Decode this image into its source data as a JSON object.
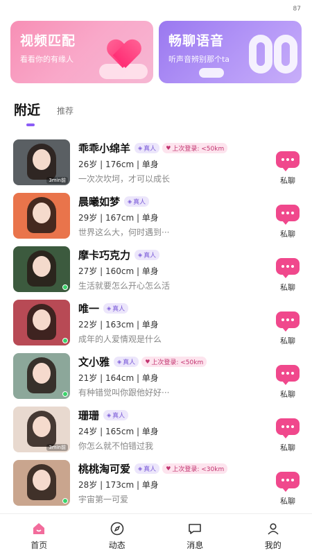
{
  "status_bar": {
    "battery": "87"
  },
  "banners": [
    {
      "title": "视频匹配",
      "subtitle": "看看你的有缘人"
    },
    {
      "title": "畅聊语音",
      "subtitle": "听声音辨别那个ta"
    }
  ],
  "tabs": {
    "active": "附近",
    "inactive": "推荐"
  },
  "users": [
    {
      "name": "乖乖小绵羊",
      "real": "真人",
      "login": "上次登录: <50km",
      "stats": "26岁 | 176cm | 单身",
      "bio": "一次次坎坷，才可以成长",
      "time": "3min前",
      "online": false,
      "chat": "私聊",
      "bg": "#5a5f63"
    },
    {
      "name": "晨曦如梦",
      "real": "真人",
      "login": "",
      "stats": "29岁 | 167cm | 单身",
      "bio": "世界这么大，何时遇到···",
      "time": "",
      "online": false,
      "chat": "私聊",
      "bg": "#e9744b"
    },
    {
      "name": "摩卡巧克力",
      "real": "真人",
      "login": "",
      "stats": "27岁 | 160cm | 单身",
      "bio": "生活就要怎么开心怎么活",
      "time": "",
      "online": true,
      "chat": "私聊",
      "bg": "#3c5a3e"
    },
    {
      "name": "唯一",
      "real": "真人",
      "login": "",
      "stats": "22岁 | 163cm | 单身",
      "bio": "成年的人爱情观是什么",
      "time": "",
      "online": true,
      "chat": "私聊",
      "bg": "#b84a55"
    },
    {
      "name": "文小雅",
      "real": "真人",
      "login": "上次登录: <50km",
      "stats": "21岁 | 164cm | 单身",
      "bio": "有种错觉叫你跟他好好···",
      "time": "",
      "online": true,
      "chat": "私聊",
      "bg": "#8ca79a"
    },
    {
      "name": "珊珊",
      "real": "真人",
      "login": "",
      "stats": "24岁 | 165cm | 单身",
      "bio": "你怎么就不怕错过我",
      "time": "3min前",
      "online": false,
      "chat": "私聊",
      "bg": "#e8d9cf"
    },
    {
      "name": "桃桃淘可爱",
      "real": "真人",
      "login": "上次登录: <30km",
      "stats": "28岁 | 173cm | 单身",
      "bio": "宇宙第一可爱",
      "time": "",
      "online": true,
      "chat": "私聊",
      "bg": "#c9a58e"
    }
  ],
  "nav": [
    "首页",
    "动态",
    "消息",
    "我的"
  ],
  "colors": {
    "accent": "#8b5cf6",
    "chat": "#f0488c",
    "real_badge": "#ece6fb",
    "login_badge": "#fde4ee"
  }
}
